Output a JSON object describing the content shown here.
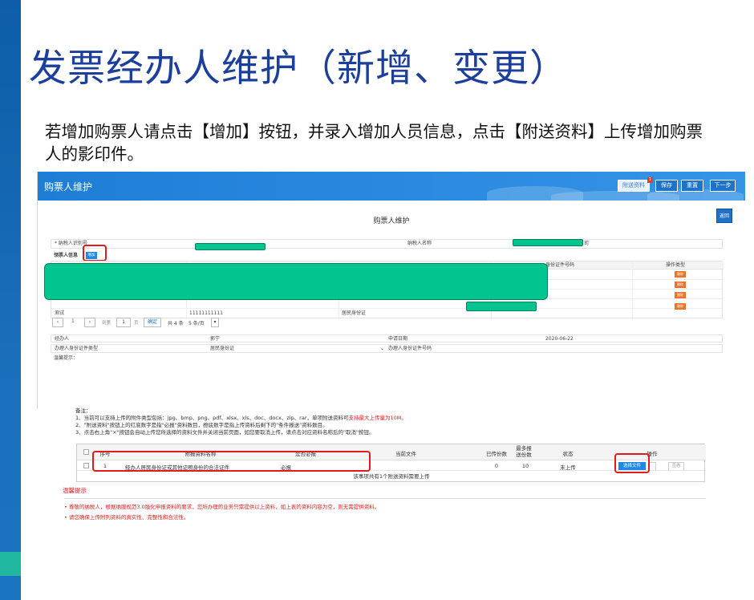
{
  "slide": {
    "title": "发票经办人维护（新增、变更）",
    "description": "若增加购票人请点击【增加】按钮，并录入增加人员信息，点击【附送资料】上传增加购票人的影印件。"
  },
  "screen1": {
    "header": {
      "title": "购票人维护",
      "buttons": [
        "附送资料",
        "保存",
        "重置",
        "下一步"
      ],
      "badge": "1"
    },
    "form_title": "购票人维护",
    "back_label": "返回",
    "taxpayer_id_label": "* 纳税人识别号",
    "taxpayer_name_label": "纳税人名称",
    "taxpayer_name_suffix": "司",
    "buyer_info_label": "领票人信息",
    "add_label": "增加",
    "table_headers": {
      "id_no": "身份证件号码",
      "op": "操作类型"
    },
    "delete_label": "删除",
    "visible_row": {
      "name": "测试",
      "phone": "11111111111",
      "id_type": "居民身份证"
    },
    "pagination": {
      "page": "1",
      "goto_label": "到第",
      "page_input": "1",
      "page_unit": "页",
      "confirm": "确定",
      "total": "共 4 条",
      "per_page": "5 条/页"
    },
    "agent_label": "经办人",
    "agent_value": "郭宁",
    "apply_date_label": "申请日期",
    "apply_date_value": "2020-06-22",
    "id_type_label": "办理人身份证件类型",
    "id_type_value": "居民身份证",
    "id_no_label": "办理人身份证件号码",
    "tips_label": "温馨提示："
  },
  "screen2": {
    "notes": {
      "title": "备注：",
      "line1_a": "1、当前可以支持上传的附件类型包括：jpg、bmp、png、pdf、xlsx、xls、doc、docx、zip、rar，单项附送资料可",
      "line1_b": "支持最大上传量为10M。",
      "line2": "2、\"附送资料\"按钮上的红底数字是指\"必报\"资料数目，橙底数字是指上传资料后剩下的\"条件报送\"资料数目。",
      "line3": "3、点击右上角\"×\"按钮会自动上传您所选择的资料文件并关闭当前页面，如您要取消上传，请点击对应资料名称后的\"取消\"按钮。"
    },
    "table": {
      "headers": [
        "序号",
        "附报资料名称",
        "是否必报",
        "当前文件",
        "已传份数",
        "最多报送份数",
        "状态",
        "操作"
      ],
      "row": {
        "index": "1",
        "name": "经办人居民身份证或其他证明身份的合法证件",
        "required": "必报",
        "current_file": "",
        "uploaded": "0",
        "max": "10",
        "status": "未上传"
      },
      "select_file": "选择文件",
      "view": "查看",
      "footer": "该事项共有1个附送资料需要上传"
    },
    "warm": {
      "title": "温馨提示",
      "item1": "尊敬的纳税人，根据纳服规范3.0版化申报资料的要求，您所办理的业务只需提供以上资料，如上表的资料内容为空，则无需提供资料。",
      "item2": "请您确保上传附列资料的真实性、完整性和合法性。"
    }
  },
  "colors": {
    "title_blue": "#1c3f9c",
    "header_blue": "#1e7ed6",
    "mask_green": "#00c58f",
    "highlight_red": "#e41a1a",
    "delete_orange": "#f07128"
  }
}
